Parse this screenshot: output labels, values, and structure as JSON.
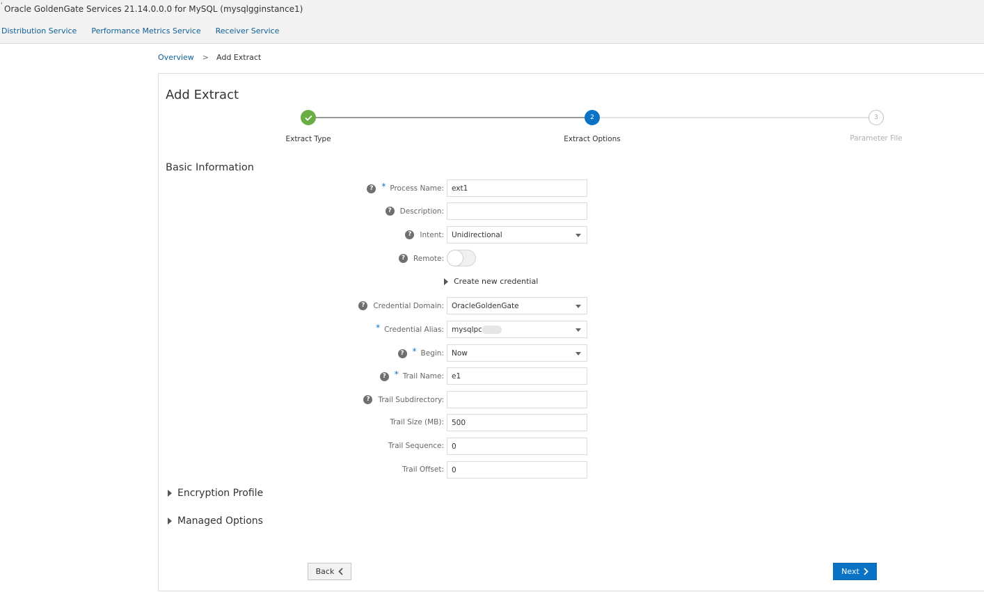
{
  "app_title": "Oracle GoldenGate Services 21.14.0.0.0 for MySQL (mysqlgginstance1)",
  "nav": [
    "Distribution Service",
    "Performance Metrics Service",
    "Receiver Service"
  ],
  "breadcrumb": {
    "link": "Overview",
    "separator": ">",
    "current": "Add Extract"
  },
  "page_title": "Add Extract",
  "train": {
    "step1": {
      "label": "Extract Type",
      "state": "complete",
      "icon": "check-icon"
    },
    "step2": {
      "label": "Extract Options",
      "number": "2",
      "state": "current"
    },
    "step3": {
      "label": "Parameter File",
      "number": "3",
      "state": "disabled"
    }
  },
  "section_basic": "Basic Information",
  "fields": {
    "process_name": {
      "label": "Process Name:",
      "value": "ext1",
      "required": "*"
    },
    "description": {
      "label": "Description:",
      "value": ""
    },
    "intent": {
      "label": "Intent:",
      "value": "Unidirectional"
    },
    "remote": {
      "label": "Remote:",
      "state": "off"
    },
    "create_credential": "Create new credential",
    "credential_domain": {
      "label": "Credential Domain:",
      "value": "OracleGoldenGate"
    },
    "credential_alias": {
      "label": "Credential Alias:",
      "value": "mysqlpc",
      "required": "*"
    },
    "begin": {
      "label": "Begin:",
      "value": "Now",
      "required": "*"
    },
    "trail_name": {
      "label": "Trail Name:",
      "value": "e1",
      "required": "*"
    },
    "trail_subdirectory": {
      "label": "Trail Subdirectory:",
      "value": ""
    },
    "trail_size": {
      "label": "Trail Size (MB):",
      "value": "500"
    },
    "trail_sequence": {
      "label": "Trail Sequence:",
      "value": "0"
    },
    "trail_offset": {
      "label": "Trail Offset:",
      "value": "0"
    }
  },
  "help_glyph": "?",
  "sections": {
    "encryption": "Encryption Profile",
    "managed": "Managed Options"
  },
  "buttons": {
    "back": "Back",
    "next": "Next"
  },
  "colors": {
    "accent": "#0b73c5",
    "complete": "#6aad45",
    "link": "#0b5e95"
  }
}
